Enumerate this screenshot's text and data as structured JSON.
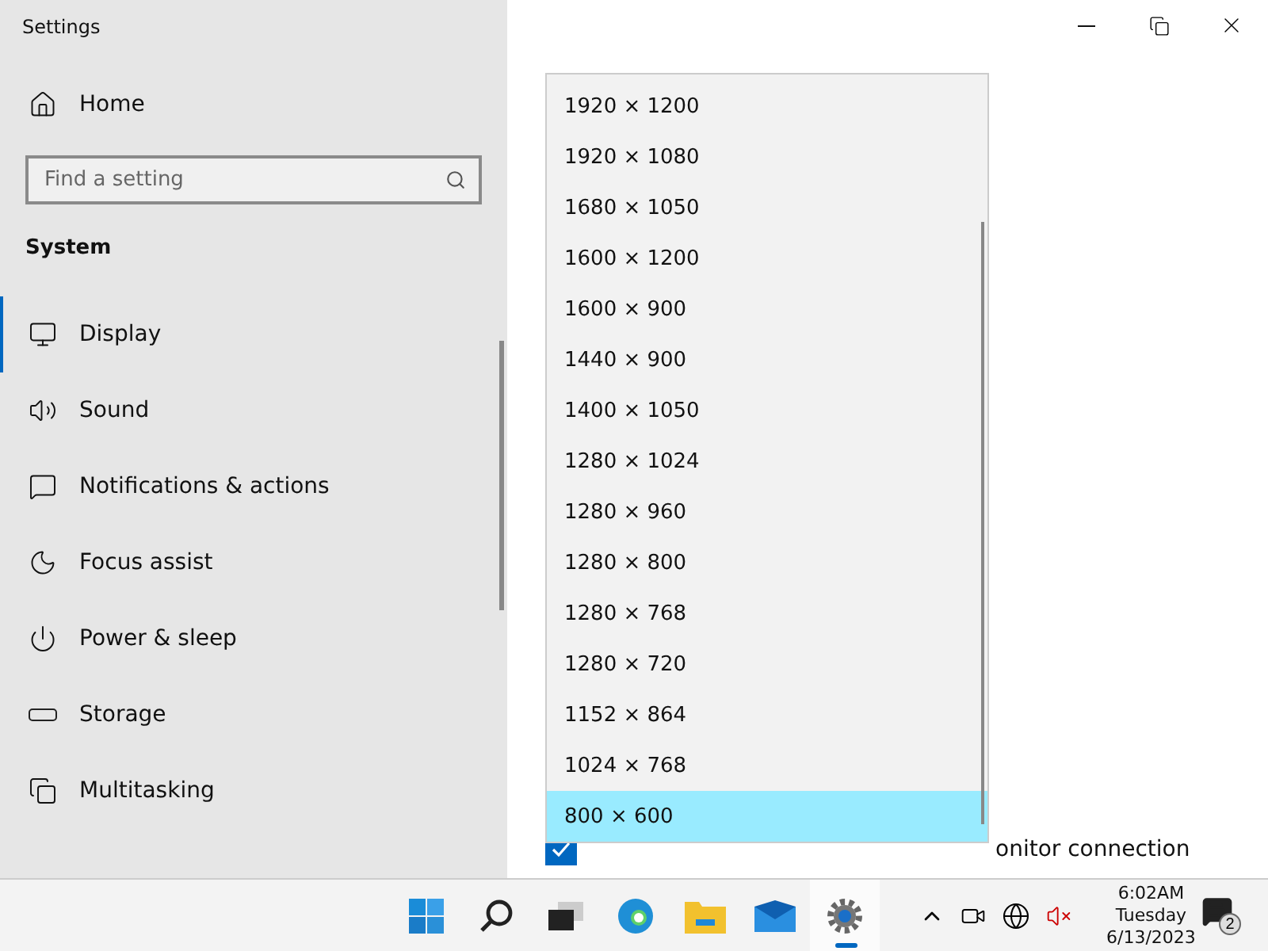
{
  "window": {
    "title": "Settings"
  },
  "sidebar": {
    "home": "Home",
    "search": {
      "placeholder": "Find a setting"
    },
    "section": "System",
    "items": [
      {
        "label": "Display",
        "selected": true
      },
      {
        "label": "Sound",
        "selected": false
      },
      {
        "label": "Notifications & actions",
        "selected": false
      },
      {
        "label": "Focus assist",
        "selected": false
      },
      {
        "label": "Power & sleep",
        "selected": false
      },
      {
        "label": "Storage",
        "selected": false
      },
      {
        "label": "Multitasking",
        "selected": false
      }
    ]
  },
  "content": {
    "checkbox": {
      "label": "onitor connection",
      "checked": true
    }
  },
  "dropdown": {
    "options": [
      {
        "label": "1920 × 1200",
        "selected": false
      },
      {
        "label": "1920 × 1080",
        "selected": false
      },
      {
        "label": "1680 × 1050",
        "selected": false
      },
      {
        "label": "1600 × 1200",
        "selected": false
      },
      {
        "label": "1600 × 900",
        "selected": false
      },
      {
        "label": "1440 × 900",
        "selected": false
      },
      {
        "label": "1400 × 1050",
        "selected": false
      },
      {
        "label": "1280 × 1024",
        "selected": false
      },
      {
        "label": "1280 × 960",
        "selected": false
      },
      {
        "label": "1280 × 800",
        "selected": false
      },
      {
        "label": "1280 × 768",
        "selected": false
      },
      {
        "label": "1280 × 720",
        "selected": false
      },
      {
        "label": "1152 × 864",
        "selected": false
      },
      {
        "label": "1024 × 768",
        "selected": false
      },
      {
        "label": "800 × 600",
        "selected": true
      }
    ]
  },
  "taskbar": {
    "apps": [
      {
        "kind": "start",
        "active": false
      },
      {
        "kind": "search",
        "active": false
      },
      {
        "kind": "taskview",
        "active": false
      },
      {
        "kind": "edge",
        "active": false
      },
      {
        "kind": "explorer",
        "active": false
      },
      {
        "kind": "mail",
        "active": false
      },
      {
        "kind": "settings",
        "active": true
      }
    ],
    "time": "6:02AM",
    "day": "Tuesday",
    "date": "6/13/2023",
    "notifications": "2"
  }
}
